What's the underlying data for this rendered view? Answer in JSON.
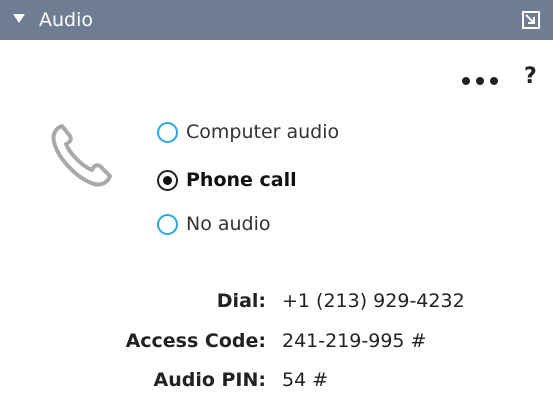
{
  "panel": {
    "title": "Audio",
    "accent_color": "#6e7d93",
    "icons": {
      "caret": "caret-down-icon",
      "popout": "popout-icon",
      "more": "more-dots-icon",
      "help": "help-icon",
      "phone": "phone-icon"
    }
  },
  "toolbar": {
    "help_label": "?"
  },
  "audio_options": {
    "selected": "Phone call",
    "items": [
      {
        "label": "Computer audio",
        "checked": false
      },
      {
        "label": "Phone call",
        "checked": true
      },
      {
        "label": "No audio",
        "checked": false
      }
    ],
    "radio_color": "#2aa8e0"
  },
  "phone_info": {
    "dial_label": "Dial:",
    "dial_value": "+1 (213) 929-4232",
    "access_label": "Access Code:",
    "access_value": "241-219-995 #",
    "pin_label": "Audio PIN:",
    "pin_value": "54 #"
  }
}
